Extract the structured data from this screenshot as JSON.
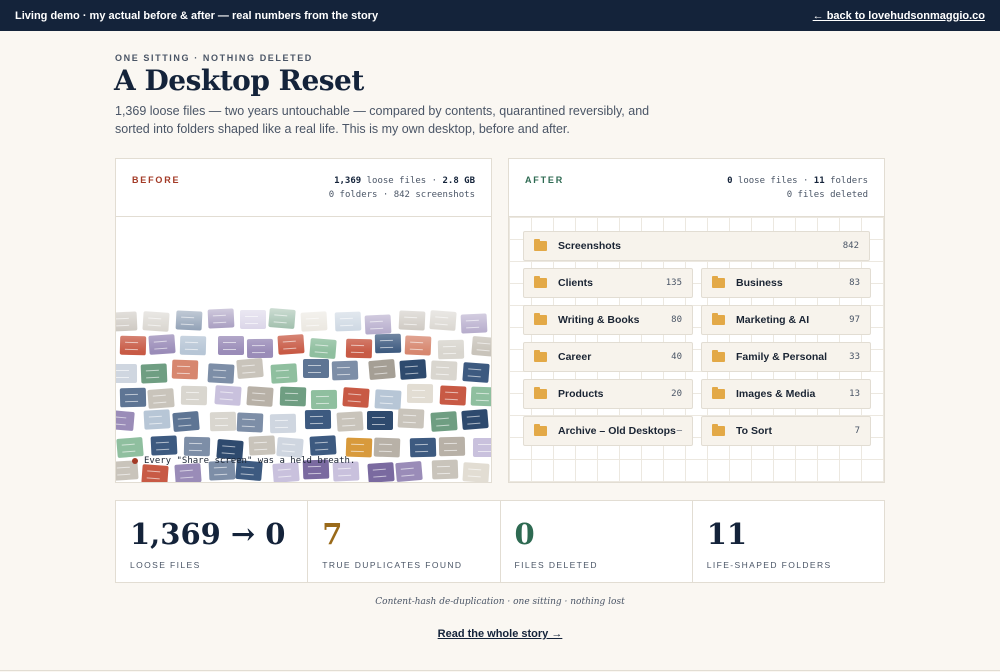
{
  "topbar": {
    "left_text": "Living demo · my actual before & after — real numbers from the story",
    "back_link": "← back to lovehudsonmaggio.co"
  },
  "hero": {
    "eyebrow": "ONE SITTING · NOTHING DELETED",
    "title": "A Desktop Reset",
    "subtitle": "1,369 loose files — two years untouchable — compared by contents, quarantined reversibly, and sorted into folders shaped like a real life. This is my own desktop, before and after."
  },
  "before": {
    "label": "BEFORE",
    "stat_line1_bold": "1,369",
    "stat_line1_mid": "loose files ·",
    "stat_line1_bold2": "2.8 GB",
    "stat_line2": "0 folders · 842 screenshots",
    "caption": "Every \"Share screen\" was a held breath.",
    "colors": [
      "#d9d6cf",
      "#c9c4bb",
      "#b8b1a7",
      "#a59f95",
      "#7d8ea7",
      "#5e7594",
      "#3d5a80",
      "#2e4a6e",
      "#9a8cb8",
      "#7a6aa0",
      "#c9c1dd",
      "#cfd6e0",
      "#b7c6d6",
      "#d7876f",
      "#c85a45",
      "#d89a3c",
      "#8fbf9f",
      "#6f9e82",
      "#e2ddd3"
    ]
  },
  "after": {
    "label": "AFTER",
    "stat_line1_bold": "0",
    "stat_line1_mid": "loose files ·",
    "stat_line1_bold2": "11",
    "stat_line1_end": "folders",
    "stat_line2": "0 files deleted",
    "folders": [
      {
        "name": "Screenshots",
        "count": "842"
      },
      {
        "name": "Clients",
        "count": "135"
      },
      {
        "name": "Business",
        "count": "83"
      },
      {
        "name": "Writing & Books",
        "count": "80"
      },
      {
        "name": "Marketing & AI",
        "count": "97"
      },
      {
        "name": "Career",
        "count": "40"
      },
      {
        "name": "Family & Personal",
        "count": "33"
      },
      {
        "name": "Products",
        "count": "20"
      },
      {
        "name": "Images & Media",
        "count": "13"
      },
      {
        "name": "Archive – Old Desktops",
        "count": "–"
      },
      {
        "name": "To Sort",
        "count": "7"
      }
    ],
    "folder_color": "#e3a947"
  },
  "stats": [
    {
      "value": "1,369 → 0",
      "label": "LOOSE FILES",
      "color": "#14233a"
    },
    {
      "value": "7",
      "label": "TRUE DUPLICATES FOUND",
      "color": "#9a6a1a"
    },
    {
      "value": "0",
      "label": "FILES DELETED",
      "color": "#2e6a52"
    },
    {
      "value": "11",
      "label": "LIFE-SHAPED FOLDERS",
      "color": "#14233a"
    }
  ],
  "footnote": "Content-hash de-duplication · one sitting · nothing lost",
  "story_link": "Read the whole story →"
}
